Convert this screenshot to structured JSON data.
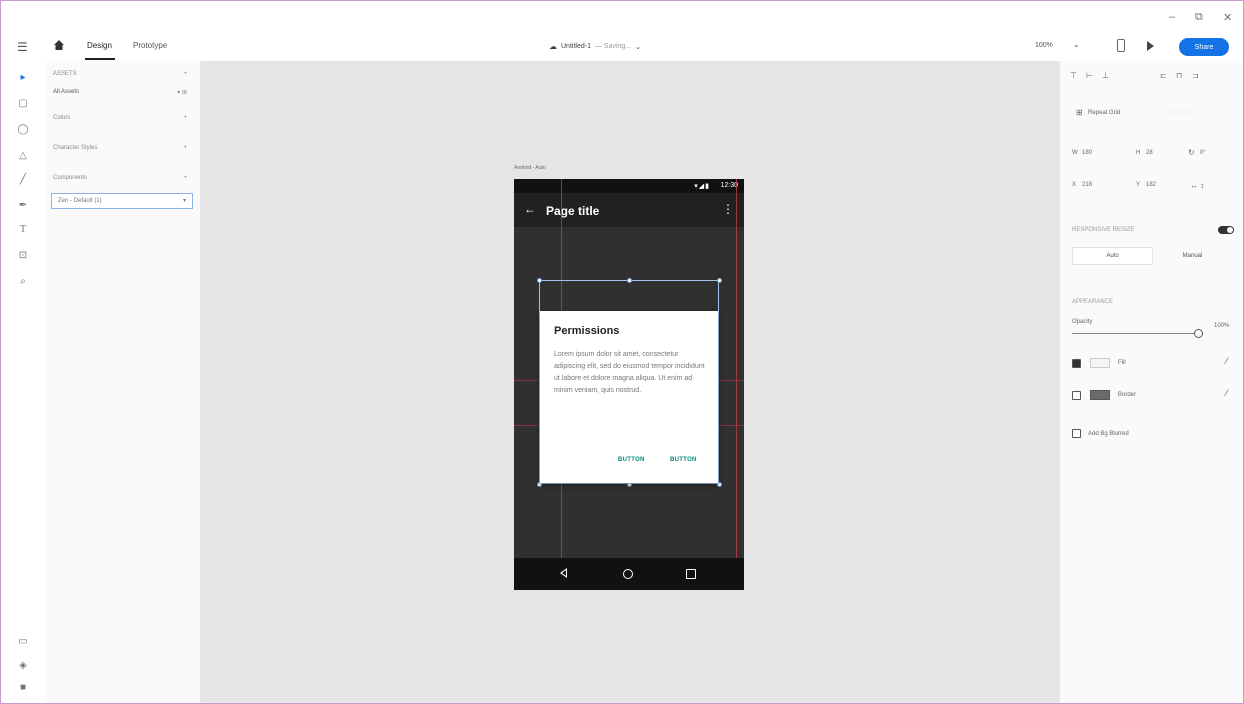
{
  "window_controls": {
    "minimize": "–",
    "maximize": "⧉",
    "close": "✕"
  },
  "appbar": {
    "tabs": [
      {
        "label": "Design",
        "active": true
      },
      {
        "label": "Prototype",
        "active": false
      }
    ],
    "document": {
      "title": "Untitled-1",
      "status": "— Saving...",
      "caret": "⌄"
    },
    "zoom": "100%",
    "zoom_caret": "⌄",
    "share_label": "Share"
  },
  "layers": {
    "rows": [
      {
        "label": "ASSETS",
        "caret": "+"
      },
      {
        "label": "All Assets",
        "caret": "▾ ⊞"
      },
      {
        "label": "Colors",
        "caret": "+"
      },
      {
        "label": "Character Styles",
        "caret": "+"
      },
      {
        "label": "Components",
        "caret": "+"
      }
    ],
    "select_value": "Zen - Default (1)",
    "select_caret": "▾"
  },
  "canvas": {
    "artboard_label": "Android - Auto",
    "status": {
      "icons": "▾◢▮",
      "time": "12:30"
    },
    "page_title": "Page title",
    "back_glyph": "←",
    "more_glyph": "⋮",
    "dialog": {
      "title": "Permissions",
      "body": "Lorem ipsum dolor sit amet, consectetur adipiscing elit, sed do eiusmod tempor incididunt ut labore et dolore magna aliqua. Ut enim ad minim veniam, quis nostrud.",
      "button1": "BUTTON",
      "button2": "BUTTON"
    }
  },
  "props": {
    "repeat_grid": "Repeat Grid",
    "w_label": "W",
    "w_value": "180",
    "h_label": "H",
    "h_value": "28",
    "x_label": "X",
    "x_value": "218",
    "y_label": "Y",
    "y_value": "182",
    "rotation_value": "0°",
    "responsive_resize": "RESPONSIVE RESIZE",
    "resize_auto": "Auto",
    "resize_manual": "Manual",
    "appearance": "APPEARANCE",
    "opacity_label": "Opacity",
    "opacity_value": "100%",
    "fill_label": "Fill",
    "border_label": "Border",
    "add_bg_blur": "Add Bg Blurred",
    "eyedropper_glyph": "⁄"
  },
  "colors": {
    "accent": "#1473e6",
    "dialog_button": "#00897b",
    "guide": "#dc3c50"
  }
}
